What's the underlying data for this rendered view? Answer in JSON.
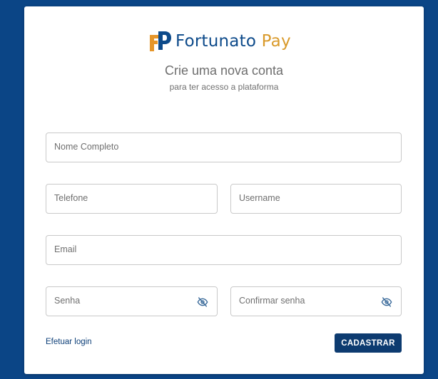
{
  "brand": {
    "name_part1": "Fortunato",
    "name_part2": "Pay",
    "primary_color": "#0d4a8a",
    "accent_color": "#d99a2b",
    "logo_icon": "fp-logo-icon"
  },
  "header": {
    "title": "Crie uma nova conta",
    "subtitle": "para ter acesso a plataforma"
  },
  "form": {
    "nome_placeholder": "Nome Completo",
    "telefone_placeholder": "Telefone",
    "username_placeholder": "Username",
    "email_placeholder": "Email",
    "senha_placeholder": "Senha",
    "confirmar_placeholder": "Confirmar senha",
    "visibility_icon": "eye-off-icon"
  },
  "actions": {
    "login_link": "Efetuar login",
    "submit_label": "CADASTRAR"
  },
  "colors": {
    "page_background": "#0b4586",
    "button_background": "#0d3b70"
  }
}
